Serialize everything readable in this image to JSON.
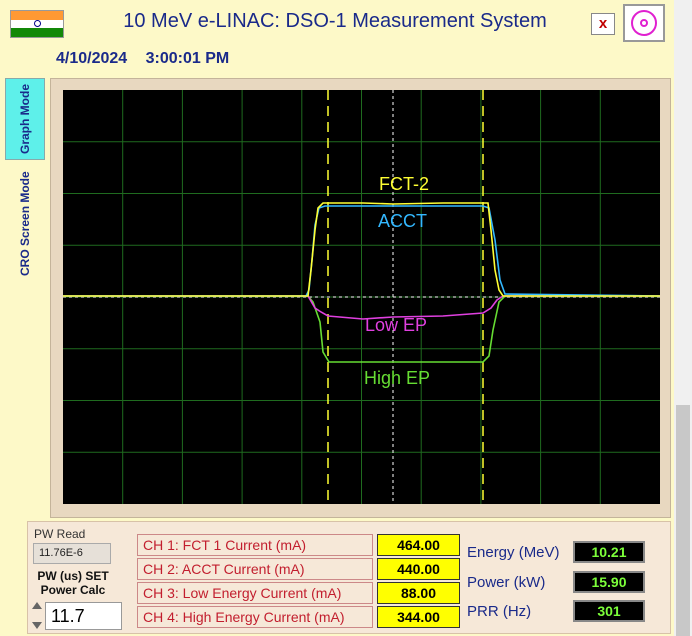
{
  "window": {
    "title": "10 MeV e-LINAC: DSO-1 Measurement System",
    "close_label": "x"
  },
  "datetime": {
    "date": "4/10/2024",
    "time": "3:00:01 PM"
  },
  "tabs": [
    {
      "label": "Graph Mode",
      "active": true
    },
    {
      "label": "CRO Screen Mode",
      "active": false
    }
  ],
  "scope": {
    "grid_color": "#1f6b1f",
    "traces": [
      {
        "name": "FCT-2",
        "color": "#ffff33"
      },
      {
        "name": "ACCT",
        "color": "#33b8ff"
      },
      {
        "name": "Low EP",
        "color": "#e040e0"
      },
      {
        "name": "High EP",
        "color": "#66dd33"
      }
    ]
  },
  "controls": {
    "pw_read_label": "PW Read",
    "pw_read_value": "11.76E-6",
    "pw_set_label": "PW (us) SET",
    "power_calc_label": "Power Calc",
    "pw_set_value": "11.7"
  },
  "channels": [
    {
      "label": "CH 1: FCT 1 Current (mA)",
      "value": "464.00"
    },
    {
      "label": "CH 2: ACCT Current (mA)",
      "value": "440.00"
    },
    {
      "label": "CH 3: Low Energy Current (mA)",
      "value": "88.00"
    },
    {
      "label": "CH 4: High Energy Current (mA)",
      "value": "344.00"
    }
  ],
  "measurements": [
    {
      "label": "Energy (MeV)",
      "value": "10.21"
    },
    {
      "label": "Power (kW)",
      "value": "15.90"
    },
    {
      "label": "PRR (Hz)",
      "value": "301"
    }
  ]
}
